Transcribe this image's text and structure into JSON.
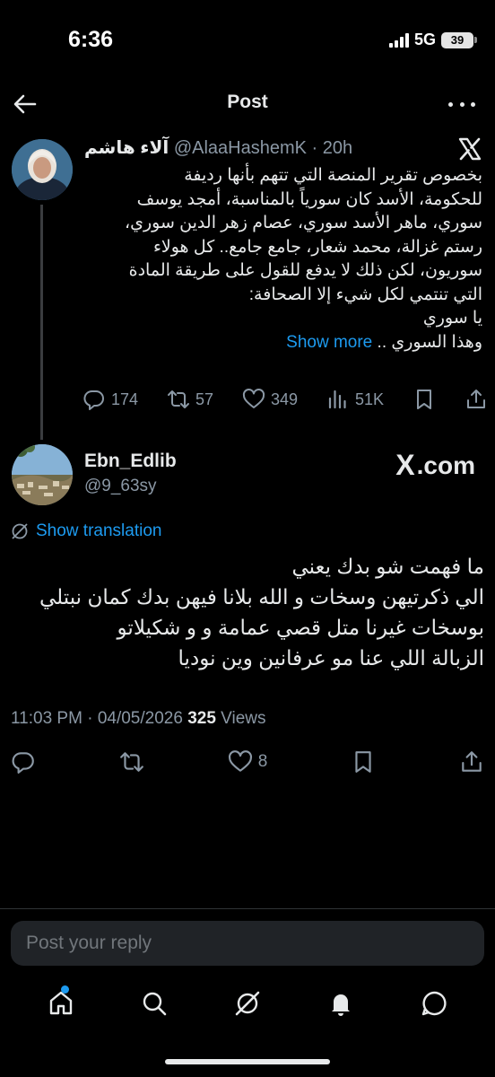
{
  "status_bar": {
    "time": "6:36",
    "network": "5G",
    "battery": "39"
  },
  "header": {
    "title": "Post"
  },
  "quoted_post": {
    "author_name": "آلاء هاشم",
    "handle": "@AlaaHashemK",
    "separator": " · ",
    "time": "20h",
    "lines": [
      "بخصوص تقرير المنصة التي تتهم بأنها رديفة",
      "للحكومة، الأسد كان سورياً بالمناسبة، أمجد يوسف",
      "سوري، ماهر الأسد سوري، عصام زهر الدين سوري،",
      "رستم غزالة، محمد شعار، جامع جامع.. كل هولاء",
      "سوريون، لكن ذلك لا يدفع للقول على طريقة المادة",
      "التي تنتمي لكل شيء إلا الصحافة:",
      "يا سوري",
      "وهذا السوري .."
    ],
    "show_more": "Show more",
    "replies": "174",
    "reposts": "57",
    "likes": "349",
    "views": "51K"
  },
  "main_post": {
    "author_name": "Ebn_Edlib",
    "handle": "@9_63sy",
    "source_brand": "X",
    "source_suffix": ".com",
    "show_translation": "Show translation",
    "lines": [
      "ما فهمت شو بدك يعني",
      "الي ذكرتيهن وسخات و الله بلانا فيهن بدك كمان نبتلي",
      "بوسخات غيرنا متل قصي عمامة و و شكيلاتو",
      "الزبالة اللي عنا مو عرفانين وين نوديا"
    ],
    "time": "11:03 PM",
    "date_separator": " · ",
    "date": "04/05/2026",
    "views_count": "325",
    "views_label": " Views",
    "likes": "8"
  },
  "reply_box": {
    "placeholder": "Post your reply"
  },
  "colors": {
    "accent": "#1d9bf0",
    "background": "#000000",
    "secondary_text": "#8b98a5"
  },
  "bottom_nav": [
    "home-icon",
    "search-icon",
    "grok-icon",
    "notifications-icon",
    "messages-icon"
  ]
}
